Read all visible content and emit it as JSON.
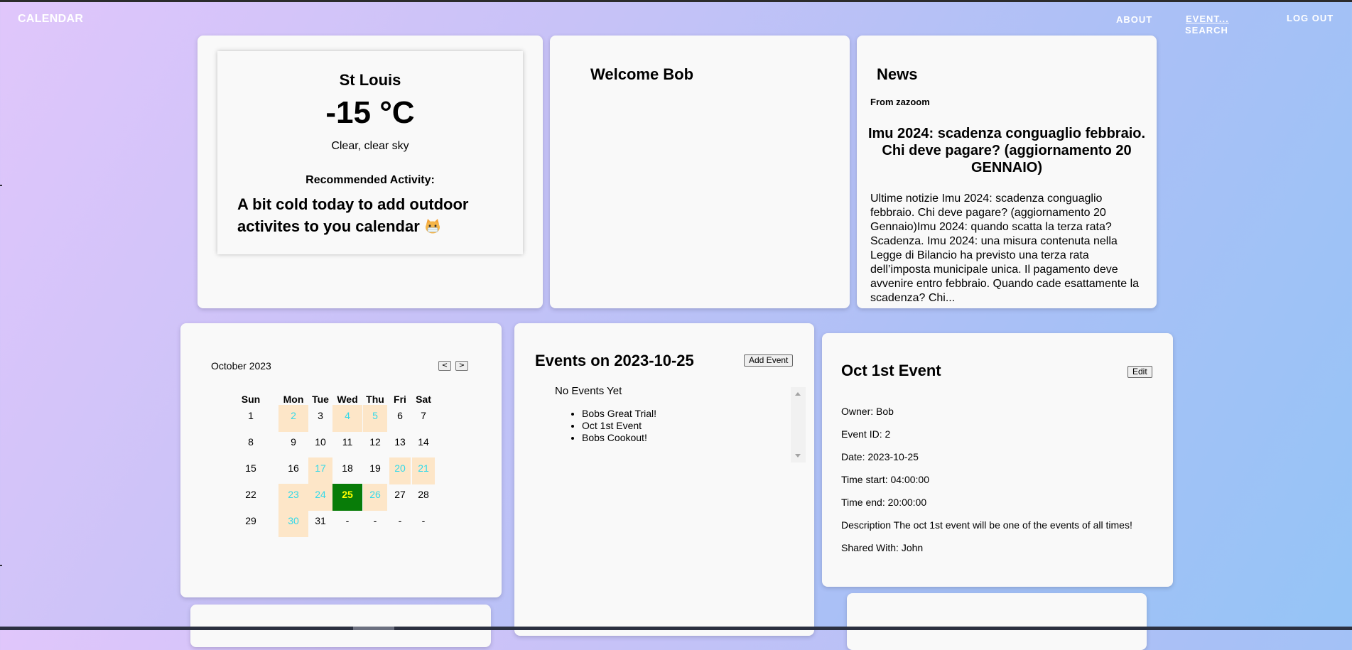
{
  "nav": {
    "brand": "CALENDAR",
    "about": "ABOUT",
    "event": "EVENT...",
    "search": "SEARCH",
    "logout": "LOG OUT"
  },
  "weather": {
    "city": "St Louis",
    "temperature": "-15 °C",
    "description": "Clear, clear sky",
    "recommended_label": "Recommended Activity:",
    "recommended_text": "A bit cold today to add outdoor activites to you calendar",
    "emoji_icon": "cold-cat-emoji-icon"
  },
  "welcome": {
    "title": "Welcome Bob"
  },
  "news": {
    "title": "News",
    "source": "From zazoom",
    "headline": "Imu 2024: scadenza conguaglio febbraio. Chi deve pagare? (aggiornamento 20 GENNAIO)",
    "body": "Ultime notizie Imu 2024: scadenza conguaglio febbraio. Chi deve pagare? (aggiornamento 20 Gennaio)Imu 2024: quando scatta la terza rata? Scadenza. Imu 2024: una misura contenuta nella Legge di Bilancio ha previsto una terza rata dell’imposta municipale unica. Il pagamento deve avvenire entro febbraio. Quando cade esattamente la scadenza? Chi..."
  },
  "calendar": {
    "month_label": "October 2023",
    "prev_label": "<",
    "next_label": ">",
    "weekdays": [
      "Sun",
      "Mon",
      "Tue",
      "Wed",
      "Thu",
      "Fri",
      "Sat"
    ],
    "weeks": [
      [
        "1",
        "2",
        "3",
        "4",
        "5",
        "6",
        "7"
      ],
      [
        "8",
        "9",
        "10",
        "11",
        "12",
        "13",
        "14"
      ],
      [
        "15",
        "16",
        "17",
        "18",
        "19",
        "20",
        "21"
      ],
      [
        "22",
        "23",
        "24",
        "25",
        "26",
        "27",
        "28"
      ],
      [
        "29",
        "30",
        "31",
        "-",
        "-",
        "-",
        "-"
      ]
    ],
    "event_days": [
      "2",
      "4",
      "5",
      "17",
      "20",
      "21",
      "23",
      "24",
      "26",
      "30"
    ],
    "selected_day": "25",
    "colors": {
      "event_bg": "#fde6c8",
      "event_text": "#33d9e9",
      "selected_bg": "#087c08",
      "selected_text": "#ffff00"
    }
  },
  "events": {
    "title": "Events on 2023-10-25",
    "add_label": "Add Event",
    "empty_text": "No Events Yet",
    "items": [
      "Bobs Great Trial!",
      "Oct 1st Event",
      "Bobs Cookout!"
    ]
  },
  "event_detail": {
    "title": "Oct 1st Event",
    "edit_label": "Edit",
    "owner": "Owner: Bob",
    "event_id": "Event ID: 2",
    "date": "Date: 2023-10-25",
    "time_start": "Time start: 04:00:00",
    "time_end": "Time end: 20:00:00",
    "description": "Description The oct 1st event will be one of the events of all times!",
    "shared_with": "Shared With: John"
  }
}
